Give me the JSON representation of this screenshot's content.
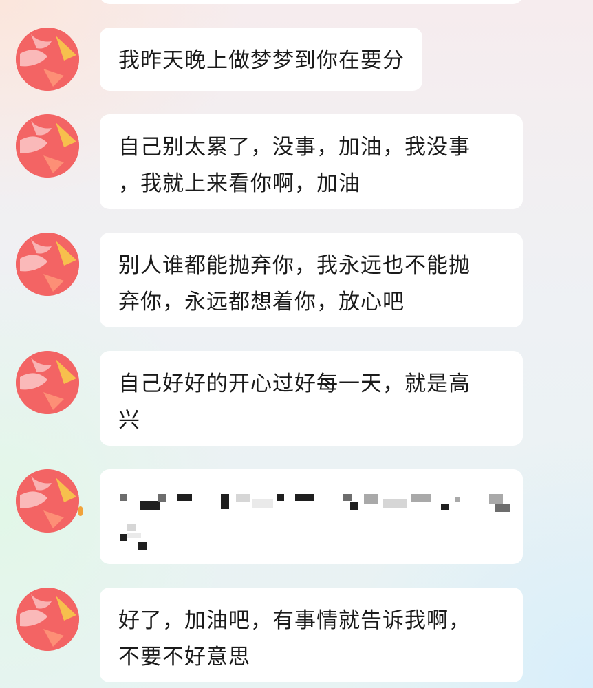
{
  "messages": [
    {
      "id": 1,
      "text": "我昨天晚上做梦梦到你在要分"
    },
    {
      "id": 2,
      "line1": "自己别太累了，没事，加油，我没事",
      "line2": "，我就上来看你啊，加油"
    },
    {
      "id": 3,
      "line1": "别人谁都能抛弃你，我永远也不能抛",
      "line2": "弃你，永远都想着你，放心吧"
    },
    {
      "id": 4,
      "line1": "自己好好的开心过好每一天，就是高",
      "line2": "兴"
    },
    {
      "id": 5,
      "redacted": true
    },
    {
      "id": 6,
      "line1": "好了，加油吧，有事情就告诉我啊，",
      "line2": "不要不好意思"
    }
  ],
  "colors": {
    "bubble": "#ffffff",
    "text": "#1b1b1b",
    "avatar_red": "#f25a5a",
    "avatar_accent": "#f7c94a"
  },
  "avatar_icon": "user-avatar-icon"
}
